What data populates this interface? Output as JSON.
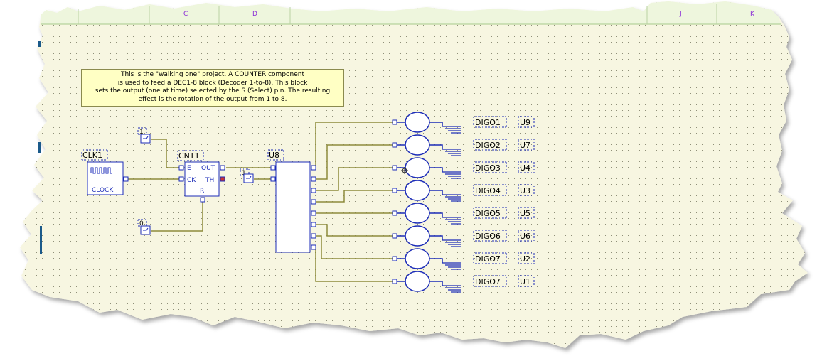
{
  "ruler": {
    "columns": [
      "C",
      "D",
      "J",
      "K"
    ]
  },
  "note": {
    "lines": [
      "This is the \"walking one\" project. A COUNTER component",
      "is used to feed  a DEC1-8 block (Decoder 1-to-8). This block",
      "sets the output (one at time) selected by the S (Select) pin. The resulting",
      "effect is the rotation of the output from 1 to 8."
    ]
  },
  "constants": {
    "enable": "1",
    "reset": "0",
    "decoder_enable": "1"
  },
  "clock": {
    "ref": "CLK1",
    "label": "CLOCK"
  },
  "counter": {
    "ref": "CNT1",
    "pins": {
      "e": "E",
      "ck": "CK",
      "r": "R",
      "out": "OUT",
      "th": "TH"
    }
  },
  "decoder": {
    "ref": "U8"
  },
  "outputs": [
    {
      "net": "DIGO1",
      "ref": "U9"
    },
    {
      "net": "DIGO2",
      "ref": "U7"
    },
    {
      "net": "DIGO3",
      "ref": "U4"
    },
    {
      "net": "DIGO4",
      "ref": "U3"
    },
    {
      "net": "DIGO5",
      "ref": "U5"
    },
    {
      "net": "DIGO6",
      "ref": "U6"
    },
    {
      "net": "DIGO7",
      "ref": "U2"
    },
    {
      "net": "DIGO7",
      "ref": "U1"
    }
  ],
  "colors": {
    "paper": "#f7f6e1",
    "grid": "#8f8f78",
    "wire": "#8d8b3c",
    "component": "#1b2bb8",
    "note_bg": "#ffffc4"
  }
}
